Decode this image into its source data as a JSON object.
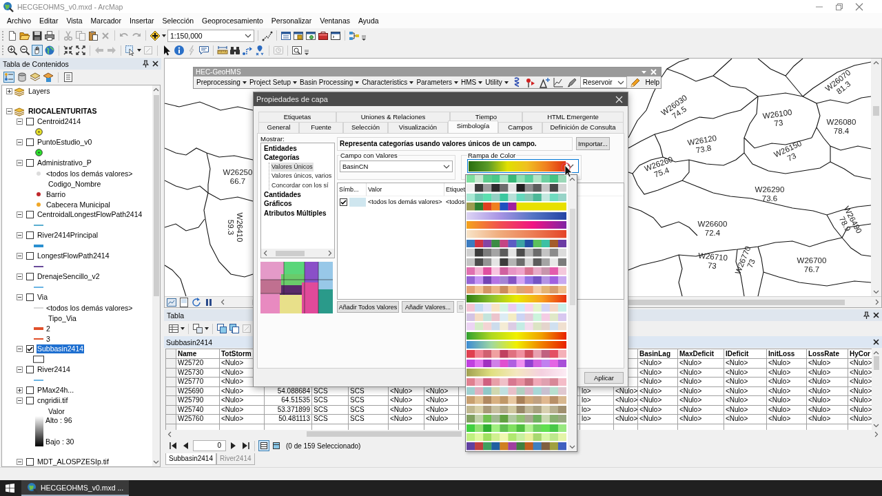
{
  "window": {
    "title": "HECGEOHMS_v0.mxd - ArcMap"
  },
  "menu": [
    "Archivo",
    "Editar",
    "Vista",
    "Marcador",
    "Insertar",
    "Selección",
    "Geoprocesamiento",
    "Personalizar",
    "Ventanas",
    "Ayuda"
  ],
  "toolbar": {
    "scale": "1:150,000"
  },
  "toc": {
    "title": "Tabla de Contenidos",
    "groups": [
      {
        "name": "Layers",
        "expanded": false,
        "active": false
      },
      {
        "name": "RIOCALENTURITAS",
        "expanded": true,
        "active": true,
        "layers": [
          {
            "name": "Centroid2414",
            "checked": false,
            "expanded": true,
            "selected": false,
            "legend": [
              {
                "kind": "marker",
                "color": "#e6e02a"
              }
            ]
          },
          {
            "name": "PuntoEstudio_v0",
            "checked": false,
            "expanded": true,
            "selected": false,
            "legend": [
              {
                "kind": "marker",
                "color": "#2ee02e"
              }
            ]
          },
          {
            "name": "Administrativo_P",
            "checked": false,
            "expanded": true,
            "selected": false,
            "legend": [
              {
                "kind": "dot",
                "label": "<todos los demás valores>",
                "color": "#dcdcdc"
              },
              {
                "kind": "heading",
                "label": "Codigo_Nombre"
              },
              {
                "kind": "dot",
                "label": "Barrio",
                "color": "#c0282c"
              },
              {
                "kind": "dot",
                "label": "Cabecera Municipal",
                "color": "#f0a828"
              }
            ]
          },
          {
            "name": "CentroidalLongestFlowPath2414",
            "checked": false,
            "expanded": true,
            "selected": false,
            "legend": [
              {
                "kind": "line",
                "color": "#5aaed0"
              }
            ]
          },
          {
            "name": "River2414Principal",
            "checked": false,
            "expanded": true,
            "selected": false,
            "legend": [
              {
                "kind": "thick-line",
                "color": "#2a90d0"
              }
            ]
          },
          {
            "name": "LongestFlowPath2414",
            "checked": false,
            "expanded": true,
            "selected": false,
            "legend": [
              {
                "kind": "line",
                "color": "#6a4a9a"
              }
            ]
          },
          {
            "name": "DrenajeSencillo_v2",
            "checked": false,
            "expanded": true,
            "selected": false,
            "legend": [
              {
                "kind": "line",
                "color": "#6ab4e4"
              }
            ]
          },
          {
            "name": "Via",
            "checked": false,
            "expanded": true,
            "selected": false,
            "legend": [
              {
                "kind": "line",
                "label": "<todos los demás valores>",
                "color": "#d8d8d8"
              },
              {
                "kind": "heading",
                "label": "Tipo_Via"
              },
              {
                "kind": "thick-line",
                "label": "2",
                "color": "#e0502a"
              },
              {
                "kind": "line",
                "label": "3",
                "color": "#e0502a"
              }
            ]
          },
          {
            "name": "Subbasin2414",
            "checked": true,
            "expanded": true,
            "selected": true,
            "legend": [
              {
                "kind": "fill"
              }
            ]
          },
          {
            "name": "River2414",
            "checked": false,
            "expanded": true,
            "selected": false,
            "legend": [
              {
                "kind": "line",
                "color": "#6ab4e4"
              }
            ]
          },
          {
            "name": "PMax24h...",
            "checked": false,
            "expanded": false,
            "selected": false
          },
          {
            "name": "cngridii.tif",
            "checked": false,
            "expanded": true,
            "selected": false,
            "legend": [
              {
                "kind": "heading",
                "label": "Valor"
              },
              {
                "kind": "ramp",
                "high": "Alto : 96",
                "low": "Bajo : 30"
              }
            ]
          },
          {
            "name": "MDT_ALOSPZESIp.tif",
            "checked": false,
            "expanded": true,
            "selected": false
          }
        ]
      }
    ]
  },
  "geohms": {
    "title": "HEC-GeoHMS",
    "menus": [
      "Preprocessing",
      "Project Setup",
      "Basin Processing",
      "Characteristics",
      "Parameters",
      "HMS",
      "Utility"
    ],
    "reservoir": "Reservoir",
    "help": "Help"
  },
  "map": {
    "labels": [
      {
        "name": "W26250",
        "value": "66.7"
      },
      {
        "name": "W26410",
        "value": "59.3"
      },
      {
        "name": "W26030",
        "value": "74.5"
      },
      {
        "name": "W26100",
        "value": "73"
      },
      {
        "name": "W26070",
        "value": "81.3"
      },
      {
        "name": "W26080",
        "value": "78.4"
      },
      {
        "name": "W26120",
        "value": "73.8"
      },
      {
        "name": "W26150",
        "value": "73"
      },
      {
        "name": "W26260",
        "value": "75.4"
      },
      {
        "name": "W26290",
        "value": "73.6"
      },
      {
        "name": "W26600",
        "value": "72.4"
      },
      {
        "name": "W26490",
        "value": "78.9"
      },
      {
        "name": "W26710",
        "value": "73"
      },
      {
        "name": "W26770",
        "value": "73"
      },
      {
        "name": "W26700",
        "value": "76.7"
      }
    ]
  },
  "dialog": {
    "title": "Propiedades de capa",
    "tabs": [
      [
        {
          "label": "Etiquetas",
          "selected": false
        },
        {
          "label": "Uniones & Relaciones",
          "selected": false
        },
        {
          "label": "Tiempo",
          "selected": false
        },
        {
          "label": "HTML Emergente",
          "selected": false
        }
      ],
      [
        {
          "label": "General",
          "selected": false
        },
        {
          "label": "Fuente",
          "selected": false
        },
        {
          "label": "Selección",
          "selected": false
        },
        {
          "label": "Visualización",
          "selected": false
        },
        {
          "label": "Simbología",
          "selected": true
        },
        {
          "label": "Campos",
          "selected": false
        },
        {
          "label": "Definición de Consulta",
          "selected": false
        }
      ]
    ],
    "show": {
      "label": "Mostrar:",
      "items": [
        {
          "label": "Entidades",
          "selected": false
        },
        {
          "label": "Categorías",
          "selected": false,
          "children": [
            {
              "label": "Valores Únicos",
              "selected": true
            },
            {
              "label": "Valores únicos, varios",
              "selected": false
            },
            {
              "label": "Concordar con los sí",
              "selected": false
            }
          ]
        },
        {
          "label": "Cantidades",
          "selected": false
        },
        {
          "label": "Gráficos",
          "selected": false
        },
        {
          "label": "Atributos Múltiples",
          "selected": false
        }
      ]
    },
    "description": "Representa categorías usando valores únicos de un campo.",
    "import_button": "Importar...",
    "value_field": {
      "label": "Campo con Valores",
      "value": "BasinCN"
    },
    "color_ramp": {
      "label": "Rampa de Color",
      "open": true
    },
    "values": {
      "columns": [
        "Símb...",
        "Valor",
        "Etiquet"
      ],
      "rows": [
        {
          "checked": true,
          "color": "#cfe6ef",
          "value": "<todos los demás valores>",
          "label": "<todos"
        }
      ]
    },
    "buttons": [
      {
        "label": "Añadir Todos Valores",
        "disabled": false
      },
      {
        "label": "Añadir Valores...",
        "disabled": false
      },
      {
        "label": "B",
        "disabled": true
      }
    ],
    "apply_button": "Aplicar"
  },
  "table": {
    "title": "Tabla",
    "layer": "Subbasin2414",
    "columns": [
      "Name",
      "TotStorm",
      null,
      null,
      null,
      null,
      null,
      null,
      null,
      null,
      "BasinLag",
      "MaxDeficit",
      "IDeficit",
      "InitLoss",
      "LossRate",
      "HyCor"
    ],
    "rows": [
      {
        "selected": false,
        "cells": [
          "W25720",
          "<Nulo>",
          null,
          null,
          null,
          null,
          null,
          null,
          null,
          null,
          "<Nulo>",
          "<Nulo>",
          "<Nulo>",
          "<Nulo>",
          "<Nulo>",
          "<Nulo>"
        ]
      },
      {
        "selected": false,
        "cells": [
          "W25730",
          "<Nulo>",
          null,
          null,
          null,
          null,
          null,
          null,
          null,
          null,
          "<Nulo>",
          "<Nulo>",
          "<Nulo>",
          "<Nulo>",
          "<Nulo>",
          "<Nulo>"
        ]
      },
      {
        "selected": false,
        "cells": [
          "W25770",
          "<Nulo>",
          null,
          null,
          null,
          null,
          null,
          null,
          null,
          null,
          "<Nulo>",
          "<Nulo>",
          "<Nulo>",
          "<Nulo>",
          "<Nulo>",
          "<Nulo>"
        ]
      },
      {
        "selected": false,
        "cells": [
          "W25690",
          "<Nulo>",
          "54.088684",
          "SCS",
          "SCS",
          "<Nulo>",
          "<Nulo>",
          null,
          "lo>",
          "<Nulo>",
          "<Nulo>",
          "<Nulo>",
          "<Nulo>",
          "<Nulo>",
          "<Nulo>",
          "<Nulo>"
        ]
      },
      {
        "selected": false,
        "cells": [
          "W25790",
          "<Nulo>",
          "64.51535",
          "SCS",
          "SCS",
          "<Nulo>",
          "<Nulo>",
          null,
          "lo>",
          "<Nulo>",
          "<Nulo>",
          "<Nulo>",
          "<Nulo>",
          "<Nulo>",
          "<Nulo>",
          "<Nulo>"
        ]
      },
      {
        "selected": false,
        "cells": [
          "W25740",
          "<Nulo>",
          "53.371899",
          "SCS",
          "SCS",
          "<Nulo>",
          "<Nulo>",
          null,
          "lo>",
          "<Nulo>",
          "<Nulo>",
          "<Nulo>",
          "<Nulo>",
          "<Nulo>",
          "<Nulo>",
          "<Nulo>"
        ]
      },
      {
        "selected": false,
        "cells": [
          "W25760",
          "<Nulo>",
          "50.481113",
          "SCS",
          "SCS",
          "<Nulo>",
          "<Nulo>",
          null,
          "lo>",
          "<Nulo>",
          "<Nulo>",
          "<Nulo>",
          "<Nulo>",
          "<Nulo>",
          "<Nulo>",
          "<Nulo>"
        ]
      }
    ],
    "record": "0",
    "selection": "(0 de 159 Seleccionado)",
    "tabs": [
      {
        "label": "Subbasin2414",
        "selected": true
      },
      {
        "label": "River2414",
        "selected": false
      }
    ]
  },
  "taskbar": {
    "apps": [
      {
        "label": "HECGEOHMS_v0.mxd ...",
        "selected": true
      }
    ]
  }
}
